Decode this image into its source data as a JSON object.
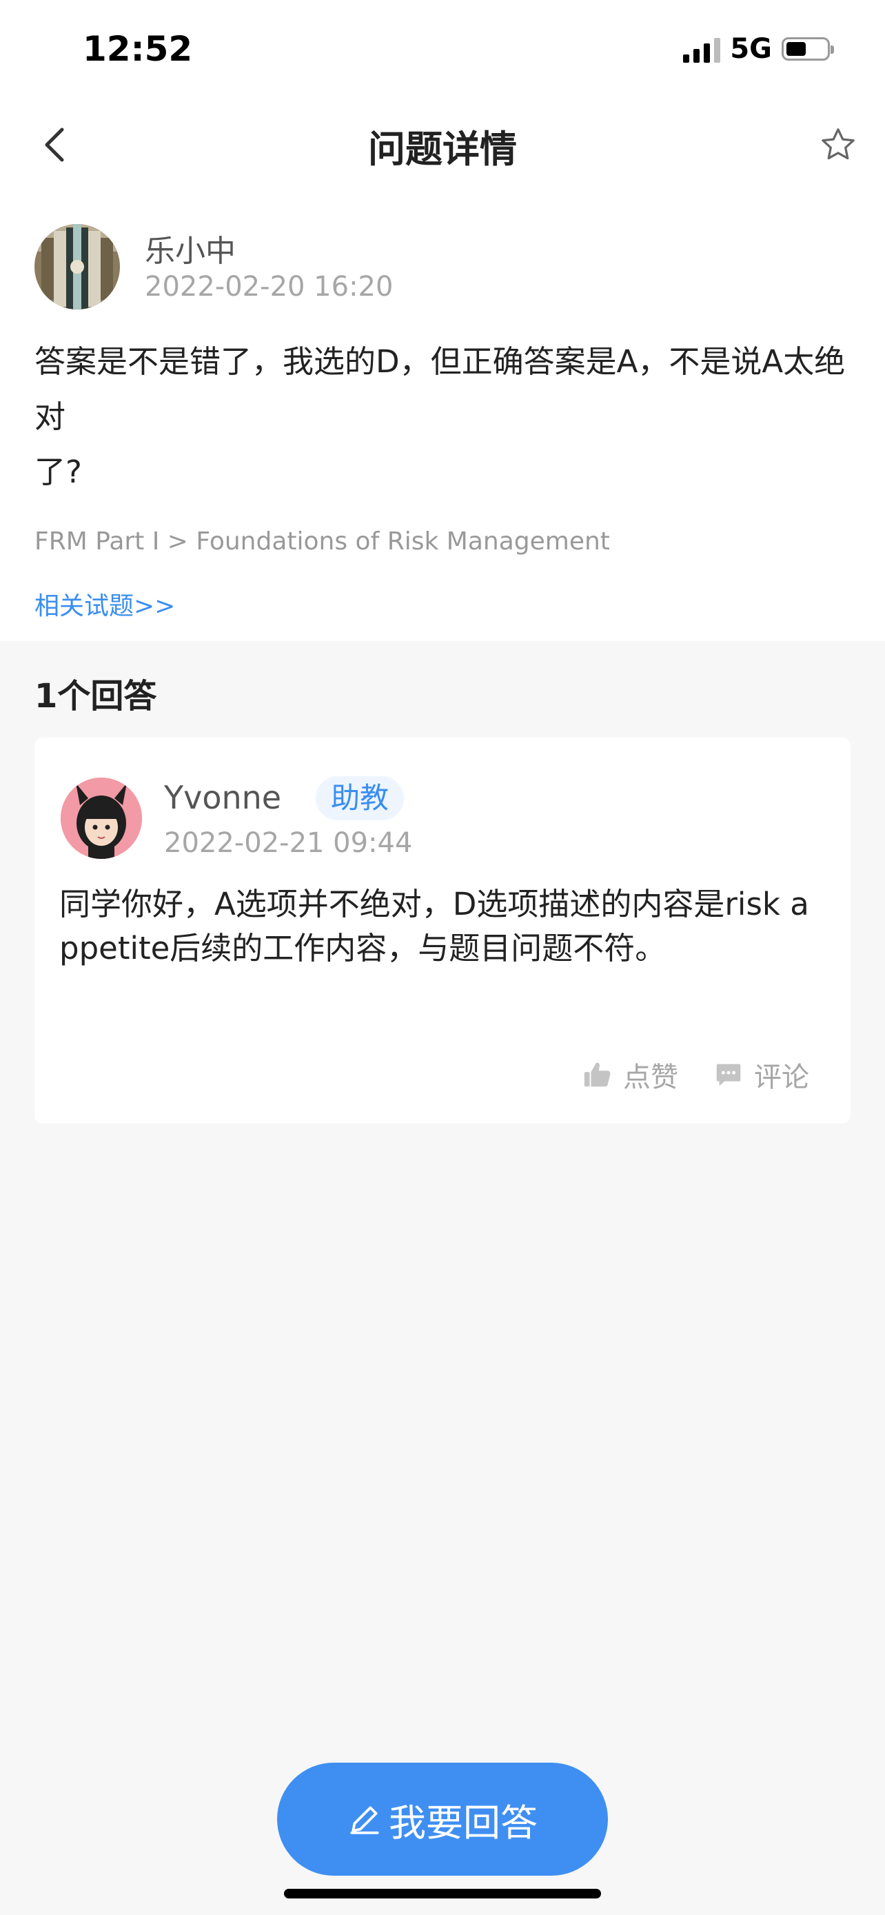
{
  "status_bar": {
    "time": "12:52",
    "network": "5G"
  },
  "nav": {
    "title": "问题详情",
    "back_icon": "chevron-left-icon",
    "favorite_icon": "star-outline-icon"
  },
  "question": {
    "author": "乐小中",
    "timestamp": "2022-02-20 16:20",
    "text": "答案是不是错了，我选的D，但正确答案是A，不是说A太绝对\n了?",
    "category": "FRM Part I > Foundations of Risk Management",
    "related_link": "相关试题>>"
  },
  "answers": {
    "heading": "1个回答",
    "items": [
      {
        "author": "Yvonne",
        "badge": "助教",
        "timestamp": "2022-02-21 09:44",
        "text": "同学你好，A选项并不绝对，D选项描述的内容是risk appetite后续的工作内容，与题目问题不符。",
        "like_label": "点赞",
        "comment_label": "评论"
      }
    ]
  },
  "footer": {
    "answer_button": "我要回答"
  },
  "colors": {
    "accent": "#3f8ff2",
    "link": "#3a8ef0",
    "muted": "#a6a6a6",
    "page_bg": "#f7f7f7"
  }
}
